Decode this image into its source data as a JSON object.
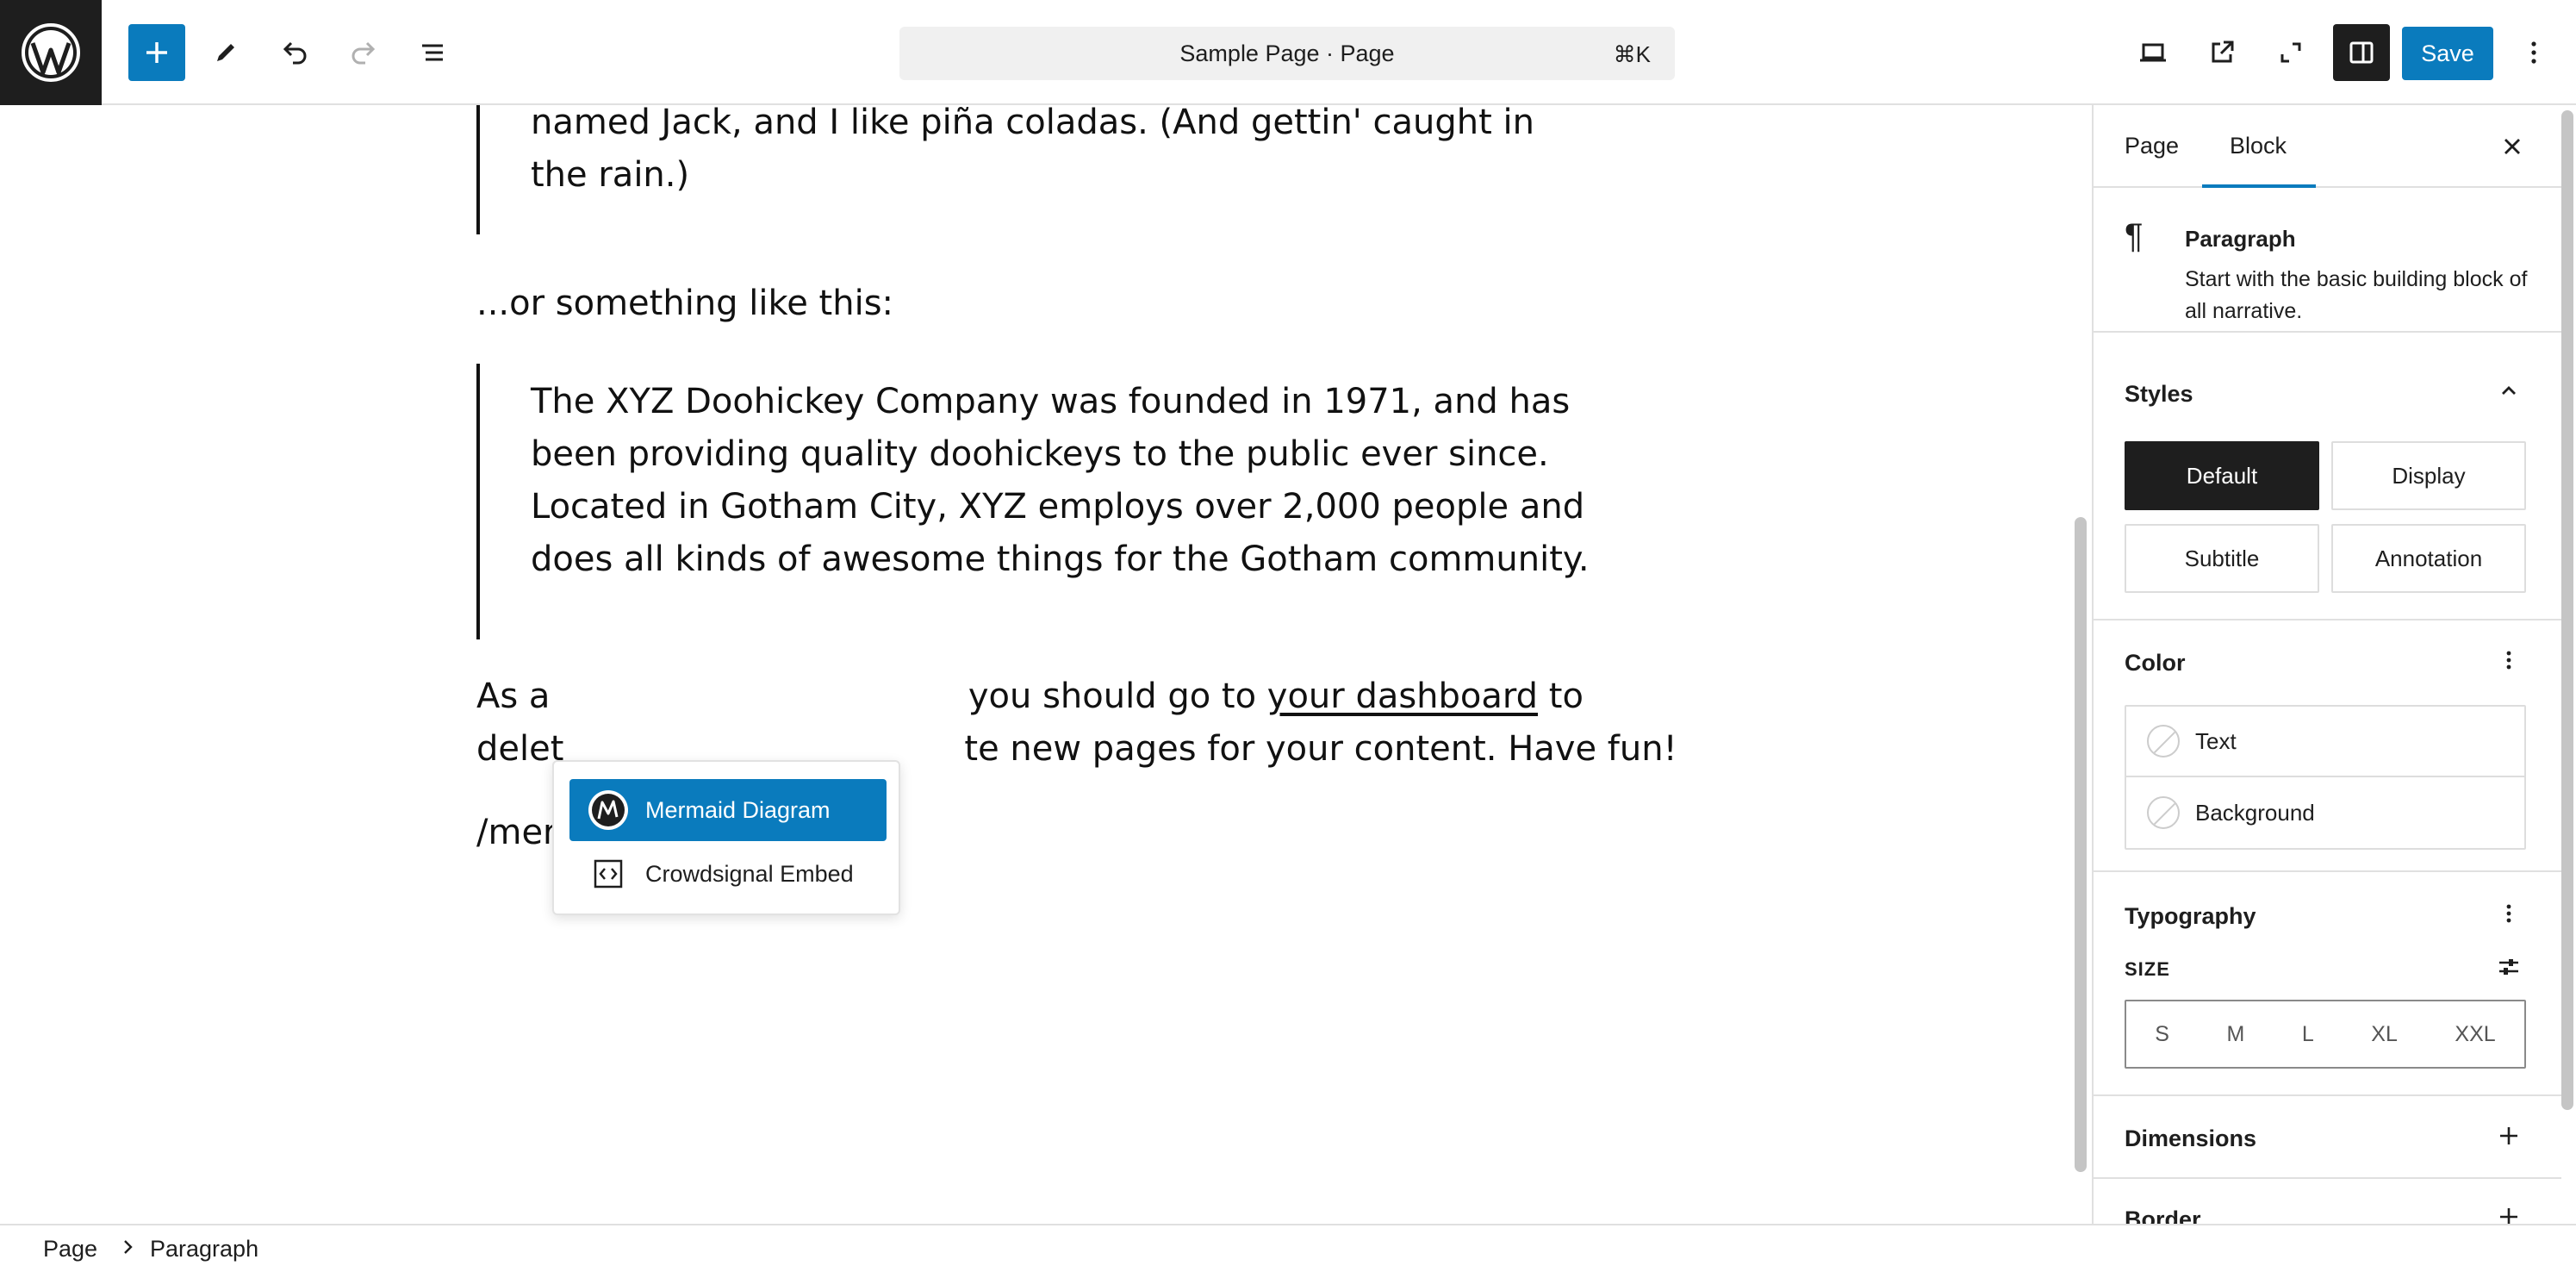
{
  "topbar": {
    "document_title": "Sample Page · Page",
    "shortcut": "⌘K",
    "save_label": "Save"
  },
  "editor": {
    "quote1_line1": "named Jack, and I like piña coladas. (And gettin' caught in",
    "quote1_line2": "the rain.)",
    "intro2": "...or something like this:",
    "quote2_lines": [
      "The XYZ Doohickey Company was founded in 1971, and has",
      "been providing quality doohickeys to the public ever since.",
      "Located in Gotham City, XYZ employs over 2,000 people and",
      "does all kinds of awesome things for the Gotham community."
    ],
    "para_line1_pre": "As a",
    "para_line1_post": "you should go to",
    "para_link": "your dashboard",
    "para_line1_end": "to",
    "para_line2_pre": "delet",
    "para_line2_post": "te new pages for your content. Have fun!",
    "slash_input": "/mer"
  },
  "autocomplete": {
    "items": [
      {
        "label": "Mermaid Diagram",
        "icon": "mermaid-icon",
        "selected": true
      },
      {
        "label": "Crowdsignal Embed",
        "icon": "embed-code-icon",
        "selected": false
      }
    ]
  },
  "sidebar": {
    "tabs": [
      "Page",
      "Block"
    ],
    "active_tab": "Block",
    "block": {
      "name": "Paragraph",
      "description": "Start with the basic building block of all narrative."
    },
    "styles": {
      "title": "Styles",
      "options": [
        "Default",
        "Display",
        "Subtitle",
        "Annotation"
      ],
      "active": "Default"
    },
    "color": {
      "title": "Color",
      "items": [
        "Text",
        "Background"
      ]
    },
    "typography": {
      "title": "Typography",
      "size_label": "SIZE",
      "sizes": [
        "S",
        "M",
        "L",
        "XL",
        "XXL"
      ]
    },
    "dimensions": {
      "title": "Dimensions"
    },
    "border": {
      "title": "Border"
    }
  },
  "footer": {
    "breadcrumb": [
      "Page",
      "Paragraph"
    ]
  },
  "colors": {
    "accent": "#0a7bbd",
    "dark": "#1e1e1e"
  }
}
